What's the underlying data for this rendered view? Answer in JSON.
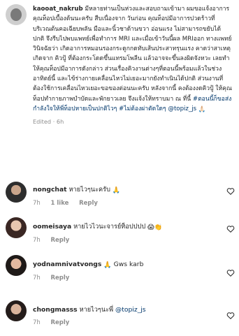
{
  "main_comment": {
    "username": "kaooat_nakrub",
    "text": "มีหลายท่านเป็นห่วงและสอบถามเข้ามา ผมขอแจ้งอาการคุณท็อปเบื้องต้นนะครับ สืบเนื่องจาก วันก่อน คุณท็อปมีอาการปวดร้าวที่บริเวณต้นคอเฉียบพลัน มือและนิ้วชาด้านขวา อ่อนแรง ไม่สามารถขยับได้ปกติ จึงรีบไปพบแพทย์เพื่อทำการ MRI และเมื่อเข้าวันนี้ผล MRIออก ทางแพทย์วินิจฉัยว่า เกิดอาการหมอนรองกระดูกกดทับเส้นประสาทรุนแรง คาดว่าสาเหตุเกิดจาก คิวปู้ ที่ต้องกระโดดขึ้นแทรมโพลีน แล้วอาจจะขึ้นลงผิดจังหวะ เลยทำให้คุณท็อปมีอาการดังกล่าว ส่วนเรื่องคิวงานต่างๆที่ตอนนี้พร้อมแล้วในช่วงอาทิตย์นี้ และไข้ร่างกายเคลื่อนไหวไม่เยอะมากยังทำเนินได้ปกติ ส่วนงานที่ต้องใช้การเคลื่อนไหวเยอะขอของต่อนนะครับ หลังจากนี้ คงต้องงดคิวปู้ ให้คุณท็อปทำกายภาพบำบัดและพักยาวเลย จึงแจ้งให้ทราบมา ณ ที่นี้",
    "hashtags": "#ตอนนี้ก็ขอส่งกำลังใจให้พี่ท็อปหายเป็นปกติไวๆ #ไม่ต้องผ่าตัดใดๆ",
    "mention": "@topiz_js",
    "emoji": "🙏🏻",
    "edited": "Edited",
    "age": "6h"
  },
  "comments": [
    {
      "username": "nongchat",
      "text": "หายไวๆนะครับ",
      "emoji": "🙏",
      "age": "7h",
      "likes": "1 like",
      "reply": "Reply"
    },
    {
      "username": "oomeisaya",
      "text": "หายไวไวนะจารย์ท็อปปปป",
      "emoji": "😱👏",
      "age": "7h",
      "likes": "",
      "reply": "Reply"
    },
    {
      "username": "yodnamnivatvongs",
      "text": "Gws karb",
      "emoji": "🙏",
      "age": "7h",
      "likes": "",
      "reply": "Reply"
    },
    {
      "username": "chongmasss",
      "text": "หายไวๆนะพี่",
      "mention": "@topiz_js",
      "emoji": "",
      "age": "7h",
      "likes": "",
      "reply": "Reply"
    }
  ],
  "icons": {
    "like": "heart-outline-icon",
    "avatar": "profile-avatar"
  }
}
